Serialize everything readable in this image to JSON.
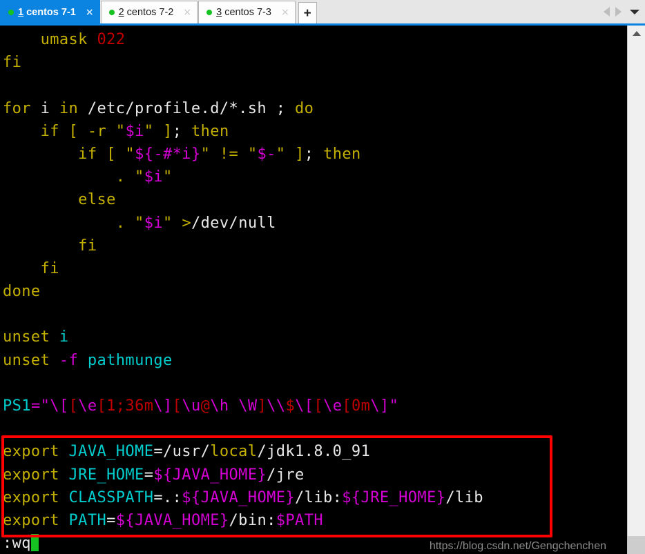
{
  "window": {
    "title": "centos 7-1 — terminal"
  },
  "tabbar": {
    "tabs": [
      {
        "num": "1",
        "name": " centos 7-1",
        "active": true,
        "status": "connected",
        "close_label": "×"
      },
      {
        "num": "2",
        "name": " centos 7-2",
        "active": false,
        "status": "connected",
        "close_label": "×"
      },
      {
        "num": "3",
        "name": " centos 7-3",
        "active": false,
        "status": "connected",
        "close_label": "×"
      }
    ],
    "new_tab_label": "+",
    "prev_tab_icon": "arrow-left-icon",
    "next_tab_icon": "arrow-right-icon",
    "tab_list_icon": "chevron-down-icon"
  },
  "terminal": {
    "background": "#000000",
    "lines": [
      {
        "id": "l01",
        "segments": [
          {
            "t": "    ",
            "c": "w"
          },
          {
            "t": "umask",
            "c": "y"
          },
          {
            "t": " ",
            "c": "w"
          },
          {
            "t": "022",
            "c": "r"
          }
        ]
      },
      {
        "id": "l02",
        "segments": [
          {
            "t": "fi",
            "c": "y"
          }
        ]
      },
      {
        "id": "l03",
        "segments": [
          {
            "t": "",
            "c": "w"
          }
        ]
      },
      {
        "id": "l04",
        "segments": [
          {
            "t": "for",
            "c": "y"
          },
          {
            "t": " i ",
            "c": "w"
          },
          {
            "t": "in",
            "c": "y"
          },
          {
            "t": " /etc/profile.d/*.sh ; ",
            "c": "w"
          },
          {
            "t": "do",
            "c": "y"
          }
        ]
      },
      {
        "id": "l05",
        "segments": [
          {
            "t": "    ",
            "c": "w"
          },
          {
            "t": "if",
            "c": "y"
          },
          {
            "t": " ",
            "c": "w"
          },
          {
            "t": "[",
            "c": "y"
          },
          {
            "t": " ",
            "c": "w"
          },
          {
            "t": "-r",
            "c": "y"
          },
          {
            "t": " \"",
            "c": "y"
          },
          {
            "t": "$i",
            "c": "m"
          },
          {
            "t": "\"",
            "c": "y"
          },
          {
            "t": " ",
            "c": "w"
          },
          {
            "t": "]",
            "c": "y"
          },
          {
            "t": "; ",
            "c": "w"
          },
          {
            "t": "then",
            "c": "y"
          }
        ]
      },
      {
        "id": "l06",
        "segments": [
          {
            "t": "        ",
            "c": "w"
          },
          {
            "t": "if",
            "c": "y"
          },
          {
            "t": " ",
            "c": "w"
          },
          {
            "t": "[",
            "c": "y"
          },
          {
            "t": " \"",
            "c": "y"
          },
          {
            "t": "${-#*i}",
            "c": "m"
          },
          {
            "t": "\"",
            "c": "y"
          },
          {
            "t": " != \"",
            "c": "y"
          },
          {
            "t": "$-",
            "c": "m"
          },
          {
            "t": "\"",
            "c": "y"
          },
          {
            "t": " ",
            "c": "w"
          },
          {
            "t": "]",
            "c": "y"
          },
          {
            "t": "; ",
            "c": "w"
          },
          {
            "t": "then",
            "c": "y"
          }
        ]
      },
      {
        "id": "l07",
        "segments": [
          {
            "t": "            ",
            "c": "w"
          },
          {
            "t": ".",
            "c": "y"
          },
          {
            "t": " \"",
            "c": "y"
          },
          {
            "t": "$i",
            "c": "m"
          },
          {
            "t": "\"",
            "c": "y"
          }
        ]
      },
      {
        "id": "l08",
        "segments": [
          {
            "t": "        ",
            "c": "w"
          },
          {
            "t": "else",
            "c": "y"
          }
        ]
      },
      {
        "id": "l09",
        "segments": [
          {
            "t": "            ",
            "c": "w"
          },
          {
            "t": ".",
            "c": "y"
          },
          {
            "t": " \"",
            "c": "y"
          },
          {
            "t": "$i",
            "c": "m"
          },
          {
            "t": "\"",
            "c": "y"
          },
          {
            "t": " ",
            "c": "w"
          },
          {
            "t": ">",
            "c": "y"
          },
          {
            "t": "/dev/null",
            "c": "w"
          }
        ]
      },
      {
        "id": "l10",
        "segments": [
          {
            "t": "        ",
            "c": "w"
          },
          {
            "t": "fi",
            "c": "y"
          }
        ]
      },
      {
        "id": "l11",
        "segments": [
          {
            "t": "    ",
            "c": "w"
          },
          {
            "t": "fi",
            "c": "y"
          }
        ]
      },
      {
        "id": "l12",
        "segments": [
          {
            "t": "done",
            "c": "y"
          }
        ]
      },
      {
        "id": "l13",
        "segments": [
          {
            "t": "",
            "c": "w"
          }
        ]
      },
      {
        "id": "l14",
        "segments": [
          {
            "t": "unset",
            "c": "y"
          },
          {
            "t": " ",
            "c": "w"
          },
          {
            "t": "i",
            "c": "c"
          }
        ]
      },
      {
        "id": "l15",
        "segments": [
          {
            "t": "unset",
            "c": "y"
          },
          {
            "t": " ",
            "c": "w"
          },
          {
            "t": "-f",
            "c": "m"
          },
          {
            "t": " ",
            "c": "w"
          },
          {
            "t": "pathmunge",
            "c": "c"
          }
        ]
      },
      {
        "id": "l16",
        "segments": [
          {
            "t": "",
            "c": "w"
          }
        ]
      },
      {
        "id": "l17",
        "segments": [
          {
            "t": "PS1",
            "c": "c"
          },
          {
            "t": "=\"",
            "c": "m"
          },
          {
            "t": "\\[",
            "c": "m"
          },
          {
            "t": "[",
            "c": "r"
          },
          {
            "t": "\\e",
            "c": "m"
          },
          {
            "t": "[1;36m",
            "c": "r"
          },
          {
            "t": "\\]",
            "c": "m"
          },
          {
            "t": "[",
            "c": "r"
          },
          {
            "t": "\\u",
            "c": "m"
          },
          {
            "t": "@",
            "c": "r"
          },
          {
            "t": "\\h",
            "c": "m"
          },
          {
            "t": " ",
            "c": "w"
          },
          {
            "t": "\\W",
            "c": "m"
          },
          {
            "t": "]",
            "c": "r"
          },
          {
            "t": "\\\\",
            "c": "m"
          },
          {
            "t": "$",
            "c": "r"
          },
          {
            "t": "\\[",
            "c": "m"
          },
          {
            "t": "[",
            "c": "r"
          },
          {
            "t": "\\e",
            "c": "m"
          },
          {
            "t": "[0m",
            "c": "r"
          },
          {
            "t": "\\]",
            "c": "m"
          },
          {
            "t": "\"",
            "c": "m"
          }
        ]
      },
      {
        "id": "l18",
        "segments": [
          {
            "t": "",
            "c": "w"
          }
        ]
      },
      {
        "id": "l19",
        "highlighted": true,
        "segments": [
          {
            "t": "export",
            "c": "y"
          },
          {
            "t": " ",
            "c": "w"
          },
          {
            "t": "JAVA_HOME",
            "c": "c"
          },
          {
            "t": "=/usr/",
            "c": "w"
          },
          {
            "t": "local",
            "c": "y"
          },
          {
            "t": "/jdk1.8.0_91",
            "c": "w"
          }
        ]
      },
      {
        "id": "l20",
        "highlighted": true,
        "segments": [
          {
            "t": "export",
            "c": "y"
          },
          {
            "t": " ",
            "c": "w"
          },
          {
            "t": "JRE_HOME",
            "c": "c"
          },
          {
            "t": "=",
            "c": "w"
          },
          {
            "t": "${",
            "c": "m"
          },
          {
            "t": "JAVA_HOME",
            "c": "m"
          },
          {
            "t": "}",
            "c": "m"
          },
          {
            "t": "/jre",
            "c": "w"
          }
        ]
      },
      {
        "id": "l21",
        "highlighted": true,
        "segments": [
          {
            "t": "export",
            "c": "y"
          },
          {
            "t": " ",
            "c": "w"
          },
          {
            "t": "CLASSPATH",
            "c": "c"
          },
          {
            "t": "=.:",
            "c": "w"
          },
          {
            "t": "${JAVA_HOME}",
            "c": "m"
          },
          {
            "t": "/lib:",
            "c": "w"
          },
          {
            "t": "${JRE_HOME}",
            "c": "m"
          },
          {
            "t": "/lib",
            "c": "w"
          }
        ]
      },
      {
        "id": "l22",
        "highlighted": true,
        "segments": [
          {
            "t": "export",
            "c": "y"
          },
          {
            "t": " ",
            "c": "w"
          },
          {
            "t": "PATH",
            "c": "c"
          },
          {
            "t": "=",
            "c": "w"
          },
          {
            "t": "${JAVA_HOME}",
            "c": "m"
          },
          {
            "t": "/bin:",
            "c": "w"
          },
          {
            "t": "$PATH",
            "c": "m"
          }
        ]
      },
      {
        "id": "l23",
        "segments": [
          {
            "t": ":wq",
            "c": "w"
          }
        ],
        "cursor": true
      }
    ],
    "command_line": ":wq",
    "cursor_color": "#16c221"
  },
  "annotation": {
    "box_color": "#fe0000",
    "box_label": "export-lines-highlight"
  },
  "watermark": {
    "text": "https://blog.csdn.net/Gengchenchen"
  },
  "scrollbar": {
    "up_arrow_icon": "chevron-up-icon",
    "thumb_position": "bottom"
  },
  "colors": {
    "accent": "#0a84e0",
    "tab_active_bg": "#0a84e0",
    "tab_inactive_bg": "#fdfdfd",
    "status_dot": "#16c221",
    "terminal_bg": "#000000",
    "keyword_yellow": "#c3b000",
    "var_cyan": "#00cdcd",
    "expansion_magenta": "#d400d4",
    "number_red": "#c00000",
    "plain_white": "#e8e8e8",
    "annotation_red": "#fe0000"
  }
}
